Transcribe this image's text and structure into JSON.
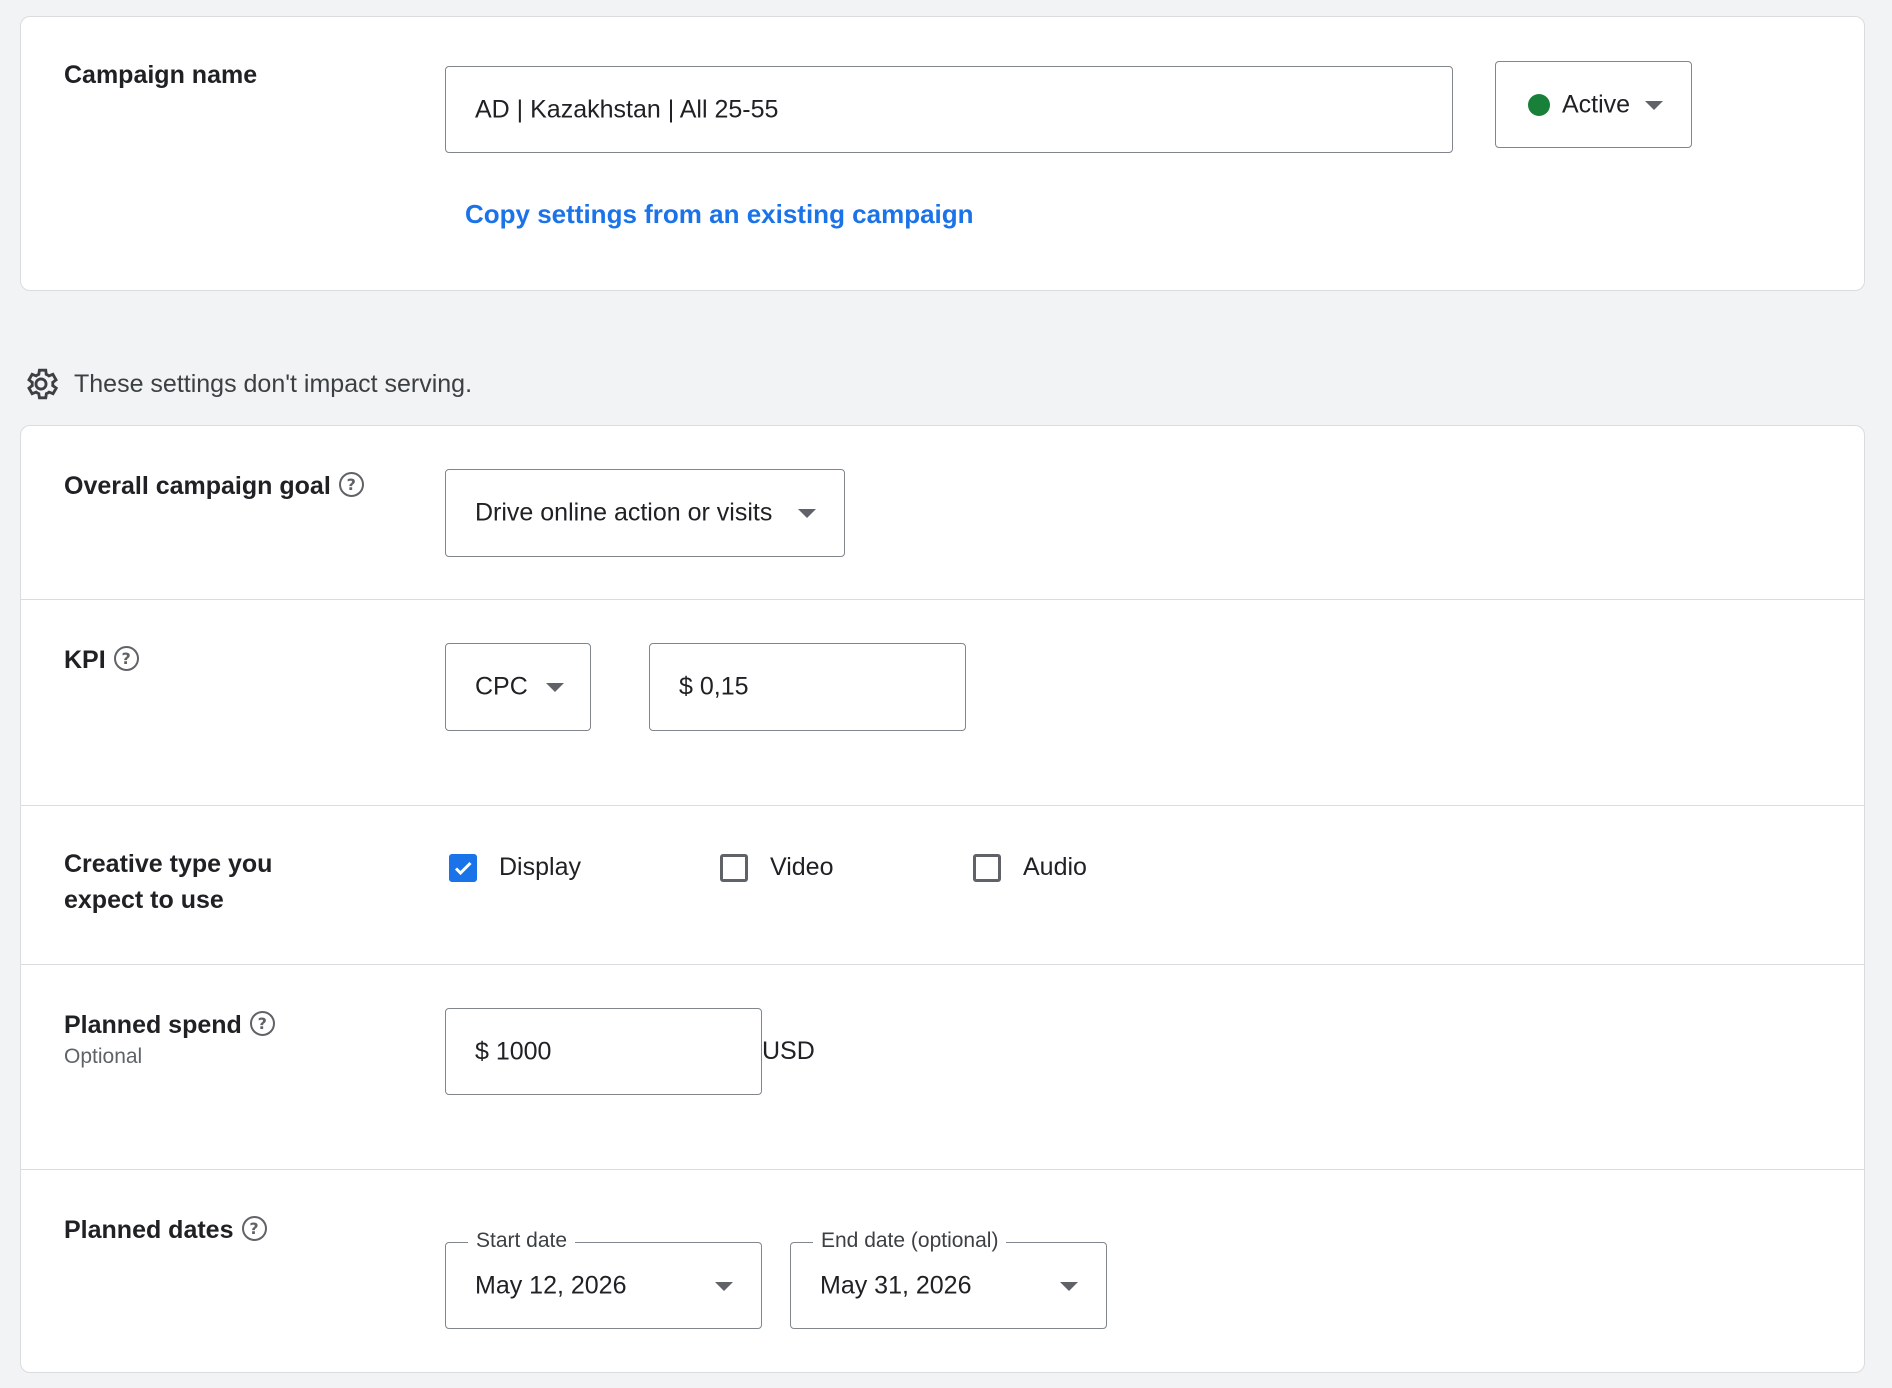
{
  "colors": {
    "accent": "#1a73e8",
    "status_active": "#188038"
  },
  "campaign": {
    "label": "Campaign name",
    "value": "AD | Kazakhstan | All 25-55",
    "status": "Active",
    "copy_link": "Copy settings from an existing campaign"
  },
  "notice": {
    "icon": "gear-icon",
    "text": "These settings don't impact serving."
  },
  "goal": {
    "label": "Overall campaign goal",
    "value": "Drive online action or visits"
  },
  "kpi": {
    "label": "KPI",
    "type": "CPC",
    "value": "$ 0,15"
  },
  "creative": {
    "label_line1": "Creative type you",
    "label_line2": "expect to use",
    "options": [
      {
        "label": "Display",
        "checked": true
      },
      {
        "label": "Video",
        "checked": false
      },
      {
        "label": "Audio",
        "checked": false
      }
    ]
  },
  "spend": {
    "label": "Planned spend",
    "sublabel": "Optional",
    "value": "$ 1000",
    "currency": "USD"
  },
  "dates": {
    "label": "Planned dates",
    "start_label": "Start date",
    "start_value": "May 12, 2026",
    "end_label": "End date (optional)",
    "end_value": "May 31, 2026"
  }
}
